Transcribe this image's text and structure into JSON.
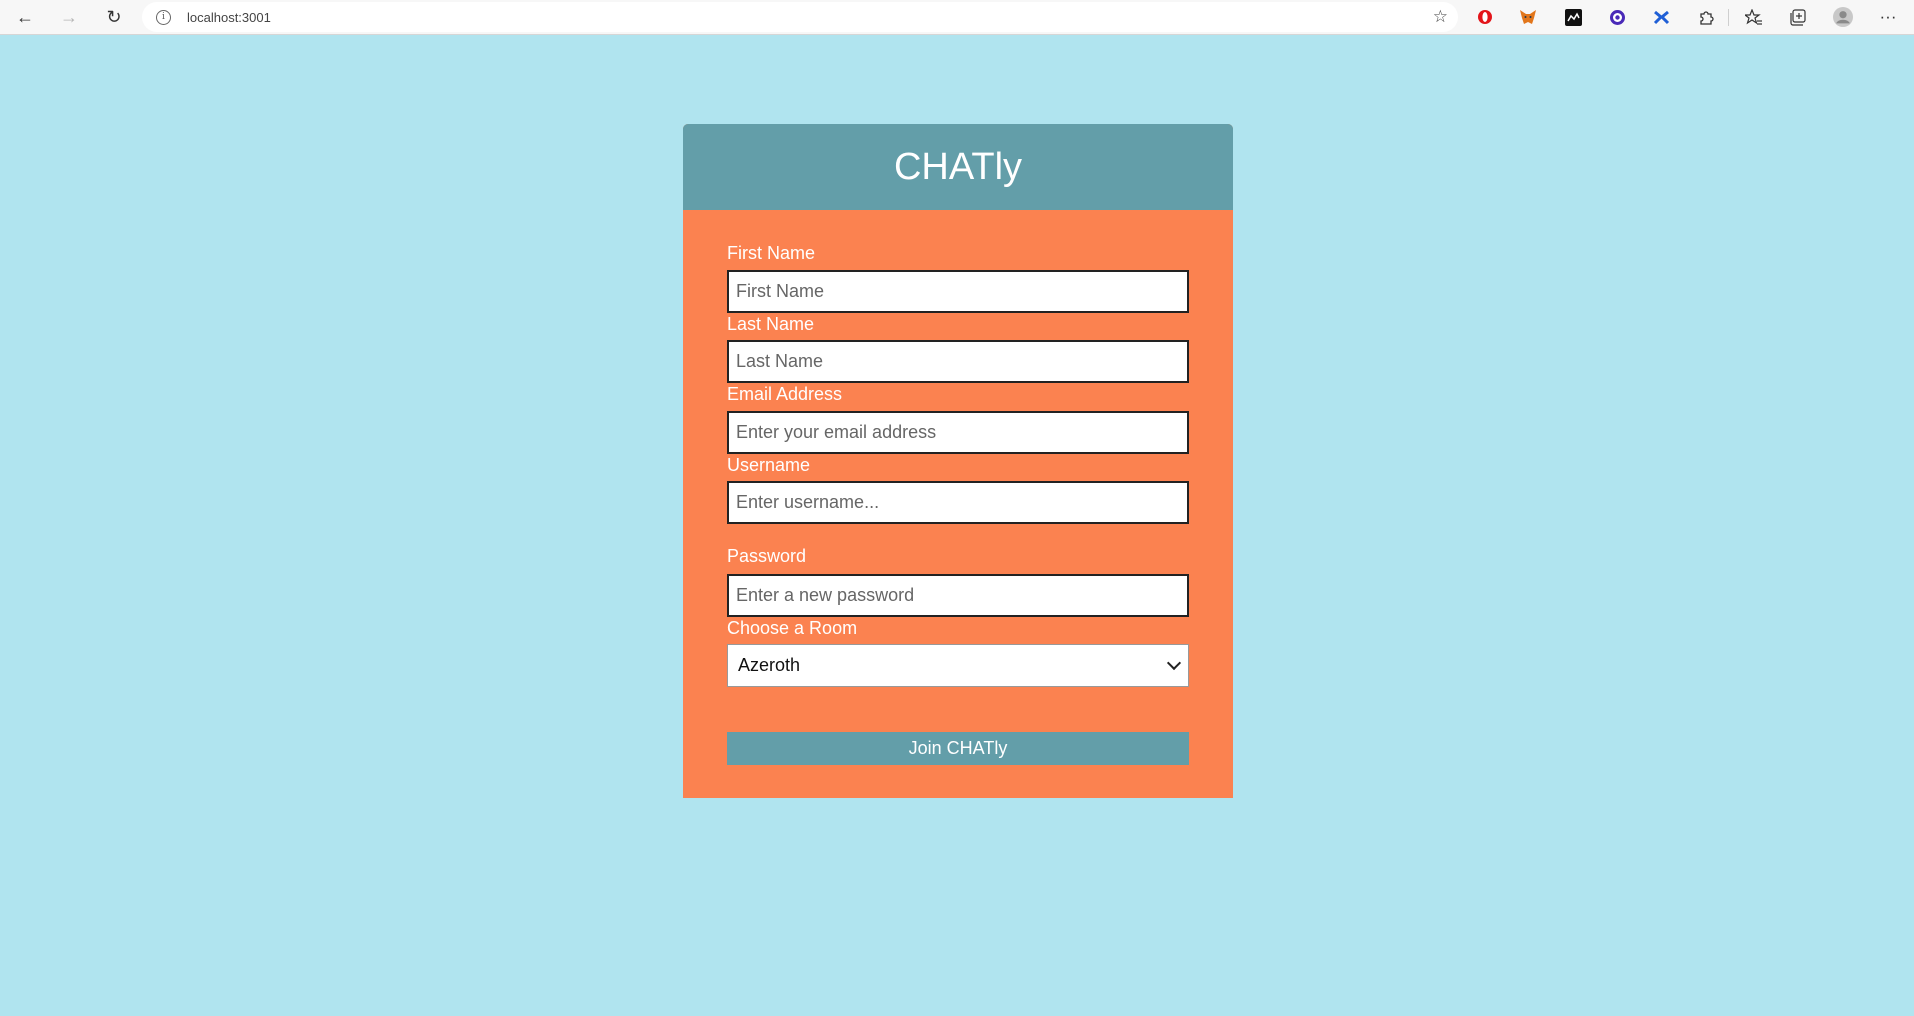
{
  "browser": {
    "url": "localhost:3001",
    "back_icon": "←",
    "forward_icon": "→",
    "reload_icon": "↻",
    "info_icon": "i",
    "extensions": [
      "opera-icon",
      "metamask-icon",
      "extension-icon",
      "extension-icon",
      "extension-icon",
      "puzzle-icon",
      "favorites-icon",
      "collections-icon",
      "profile-icon",
      "more-icon"
    ],
    "more_label": "···"
  },
  "app": {
    "title": "CHATly",
    "fields": {
      "first_name": {
        "label": "First Name",
        "placeholder": "First Name"
      },
      "last_name": {
        "label": "Last Name",
        "placeholder": "Last Name"
      },
      "email": {
        "label": "Email Address",
        "placeholder": "Enter your email address"
      },
      "username": {
        "label": "Username",
        "placeholder": "Enter username..."
      },
      "password": {
        "label": "Password",
        "placeholder": "Enter a new password"
      },
      "room": {
        "label": "Choose a Room",
        "selected": "Azeroth"
      }
    },
    "submit_label": "Join CHATly"
  },
  "colors": {
    "page_background": "#b0e4ef",
    "card_header": "#639ea9",
    "card_body": "#fb8250",
    "button": "#639ea9"
  }
}
